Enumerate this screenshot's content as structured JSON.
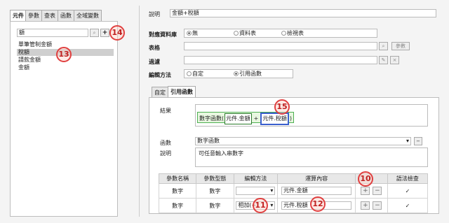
{
  "left": {
    "tabs": [
      "元件",
      "參數",
      "查表",
      "函數",
      "全域變數"
    ],
    "search_value": "額",
    "list": [
      "單筆管制金額",
      "稅額",
      "請款金額",
      "金額"
    ]
  },
  "desc": {
    "label": "說明",
    "value": "金額+稅額"
  },
  "form": {
    "source_label": "對應資料庫",
    "source_options": [
      "無",
      "資料表",
      "檢視表"
    ],
    "table_label": "表格",
    "param_btn": "參數",
    "filter_label": "過濾",
    "edit_label": "編輯方法",
    "edit_options": [
      "自定",
      "引用函數"
    ]
  },
  "inner": {
    "tabs": [
      "自定",
      "引用函數"
    ],
    "result_label": "結果",
    "expr_fn": "數字函數(",
    "expr_a": "元件.金額",
    "expr_op": "+",
    "expr_b": "元件.稅額",
    "expr_close": ")",
    "func_label": "函數",
    "func_value": "數字函數",
    "desc_label": "說明",
    "desc_value": "可任意輸入串數字"
  },
  "table": {
    "headers": [
      "參數名稱",
      "參數型態",
      "編輯方法",
      "運算內容",
      "",
      "語法檢查"
    ],
    "rows": [
      {
        "name": "數字",
        "type": "數字",
        "method": "",
        "content": "元件.金額",
        "check": "✓"
      },
      {
        "name": "數字",
        "type": "數字",
        "method": "相加(+)",
        "content": "元件.稅額",
        "check": "✓"
      }
    ]
  },
  "callouts": [
    "10",
    "11",
    "12",
    "13",
    "14",
    "15"
  ],
  "icons": {
    "search": "search-icon",
    "add": "plus-icon"
  }
}
